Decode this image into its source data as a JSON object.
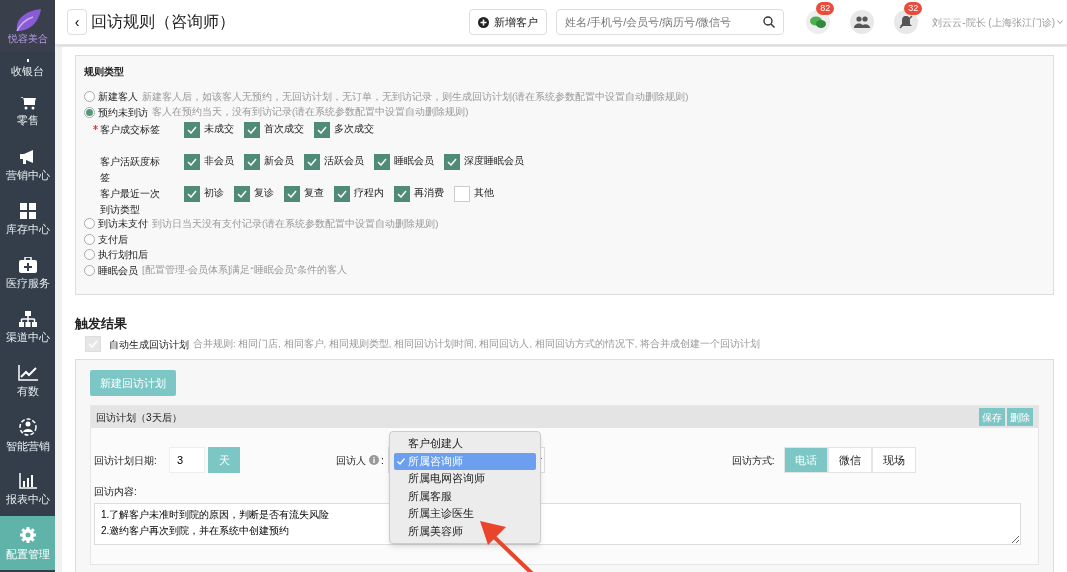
{
  "logo": {
    "text": "悦容美合"
  },
  "sidebar": {
    "items": [
      {
        "label": "收银台",
        "selected": false
      },
      {
        "label": "零售",
        "selected": false
      },
      {
        "label": "营销中心",
        "selected": false
      },
      {
        "label": "库存中心",
        "selected": false
      },
      {
        "label": "医疗服务",
        "selected": false
      },
      {
        "label": "渠道中心",
        "selected": false
      },
      {
        "label": "有数",
        "selected": false
      },
      {
        "label": "智能营销",
        "selected": false
      },
      {
        "label": "报表中心",
        "selected": false
      },
      {
        "label": "配置管理",
        "selected": true
      }
    ]
  },
  "header": {
    "back": "‹",
    "title": "回访规则（咨询师）",
    "new_customer": "新增客户",
    "search": {
      "placeholder": "姓名/手机号/会员号/病历号/微信号"
    },
    "badges": [
      "82",
      "32"
    ],
    "user": "刘云云-院长 (上海张江门诊)"
  },
  "rule_types": {
    "title": "规则类型",
    "options": [
      {
        "label": "新建客人",
        "hint": "新建客人后，如该客人无预约，无回访计划，无订单，无到访记录，则生成回访计划(请在系统参数配置中设置自动删除规则)",
        "selected": false
      },
      {
        "label": "预约未到访",
        "hint": "客人在预约当天，没有到访记录(请在系统参数配置中设置自动删除规则)",
        "selected": true,
        "groups": [
          {
            "label": "客户成交标签",
            "required": true,
            "options": [
              {
                "label": "未成交",
                "checked": true
              },
              {
                "label": "首次成交",
                "checked": true
              },
              {
                "label": "多次成交",
                "checked": true
              }
            ]
          },
          {
            "label": "客户活跃度标签",
            "required": false,
            "options": [
              {
                "label": "非会员",
                "checked": true
              },
              {
                "label": "新会员",
                "checked": true
              },
              {
                "label": "活跃会员",
                "checked": true
              },
              {
                "label": "睡眠会员",
                "checked": true
              },
              {
                "label": "深度睡眠会员",
                "checked": true
              }
            ]
          },
          {
            "label": "客户最近一次到访类型",
            "required": false,
            "options": [
              {
                "label": "初诊",
                "checked": true
              },
              {
                "label": "复诊",
                "checked": true
              },
              {
                "label": "复查",
                "checked": true
              },
              {
                "label": "疗程内",
                "checked": true
              },
              {
                "label": "再消费",
                "checked": true
              },
              {
                "label": "其他",
                "checked": false
              }
            ]
          }
        ]
      },
      {
        "label": "到访未支付",
        "hint": "到访日当天没有支付记录(请在系统参数配置中设置自动删除规则)",
        "selected": false
      },
      {
        "label": "支付后",
        "selected": false
      },
      {
        "label": "执行划扣后",
        "selected": false
      },
      {
        "label": "睡眠会员",
        "hint": "[配置管理-会员体系]满足“睡眠会员”条件的客人",
        "selected": false
      }
    ]
  },
  "trigger": {
    "title": "触发结果",
    "auto_plan": {
      "label": "自动生成回访计划",
      "hint": "合并规则: 相同门店, 相同客户, 相同规则类型, 相同回访计划时间, 相同回访人, 相同回访方式的情况下, 将合并成创建一个回访计划",
      "checked": true,
      "disabled": true
    },
    "new_plan": "新建回访计划",
    "plan": {
      "title": "回访计划（3天后）",
      "actions": [
        "保存",
        "删除"
      ],
      "date_label": "回访计划日期:",
      "days": "3",
      "unit": "天",
      "visitor_label": "回访人",
      "visitor_colon": ":",
      "visitor_options": [
        {
          "label": "客户创建人",
          "selected": false
        },
        {
          "label": "所属咨询师",
          "selected": true
        },
        {
          "label": "所属电网咨询师",
          "selected": false
        },
        {
          "label": "所属客服",
          "selected": false
        },
        {
          "label": "所属主诊医生",
          "selected": false
        },
        {
          "label": "所属美容师",
          "selected": false
        }
      ],
      "method_label": "回访方式:",
      "methods": [
        {
          "label": "电话",
          "selected": true
        },
        {
          "label": "微信",
          "selected": false
        },
        {
          "label": "现场",
          "selected": false
        }
      ],
      "content_label": "回访内容:",
      "content": "1.了解客户未准时到院的原因，判断是否有流失风险\n2.邀约客户再次到院，并在系统中创建预约"
    }
  }
}
